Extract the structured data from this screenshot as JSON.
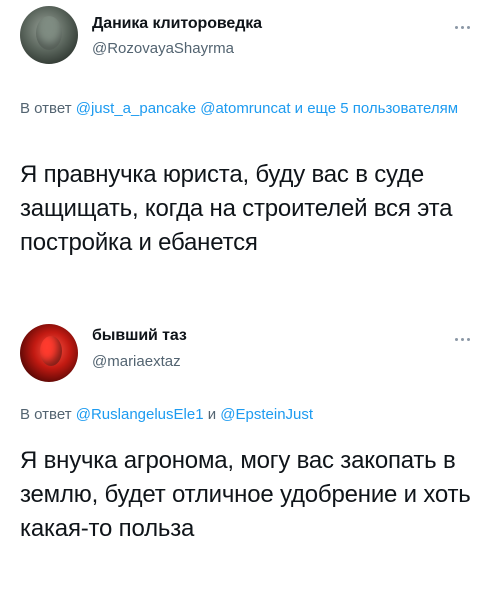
{
  "tweets": [
    {
      "user_name": "Даника клиторoведка",
      "handle": "@RozovayaShayrma",
      "avatar_icon": "user-avatar-icon",
      "reply_prefix": "В ответ",
      "mentions": [
        "@just_a_pancake",
        "@atomruncat"
      ],
      "reply_suffix": "и еще 5 пользователям",
      "text": "Я правнучка юриста, буду вас в суде защищать, когда на строителей вся эта постройка и ебанется"
    },
    {
      "user_name": "бывший таз",
      "handle": "@mariaextaz",
      "avatar_icon": "user-avatar-icon",
      "reply_prefix": "В ответ",
      "mentions": [
        "@RuslangelusEle1"
      ],
      "reply_conjunction": "и",
      "mentions_2": [
        "@EpsteinJust"
      ],
      "text": "Я внучка агронома, могу вас закопать в землю, будет отличное удобрение и хоть какая-то польза"
    }
  ],
  "colors": {
    "text": "#0f1419",
    "secondary": "#536471",
    "accent": "#1d9bf0"
  }
}
